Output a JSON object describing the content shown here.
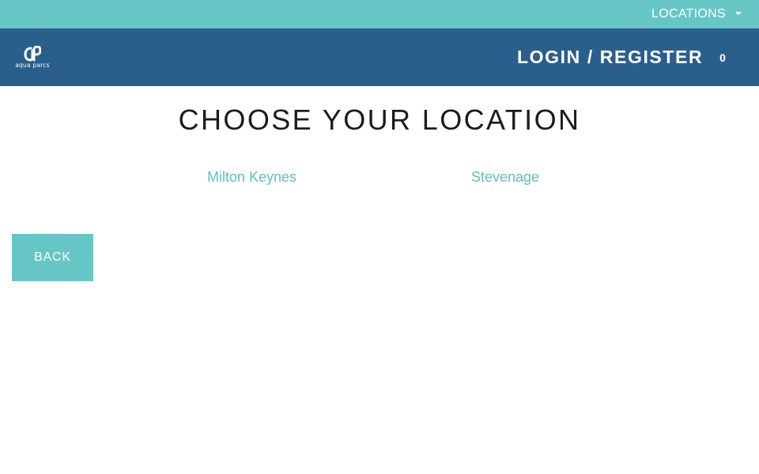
{
  "topbar": {
    "locations_label": "LOCATIONS",
    "background": "#66c6c6"
  },
  "navbar": {
    "logo_text": "aqua parcs",
    "login_label": "LOGIN / REGISTER",
    "cart_count": "0",
    "background": "#2a5f8c"
  },
  "main": {
    "title": "CHOOSE YOUR LOCATION",
    "locations": [
      {
        "label": "Milton Keynes"
      },
      {
        "label": "Stevenage"
      }
    ],
    "back_label": "BACK",
    "link_color": "#5ebfbf"
  }
}
